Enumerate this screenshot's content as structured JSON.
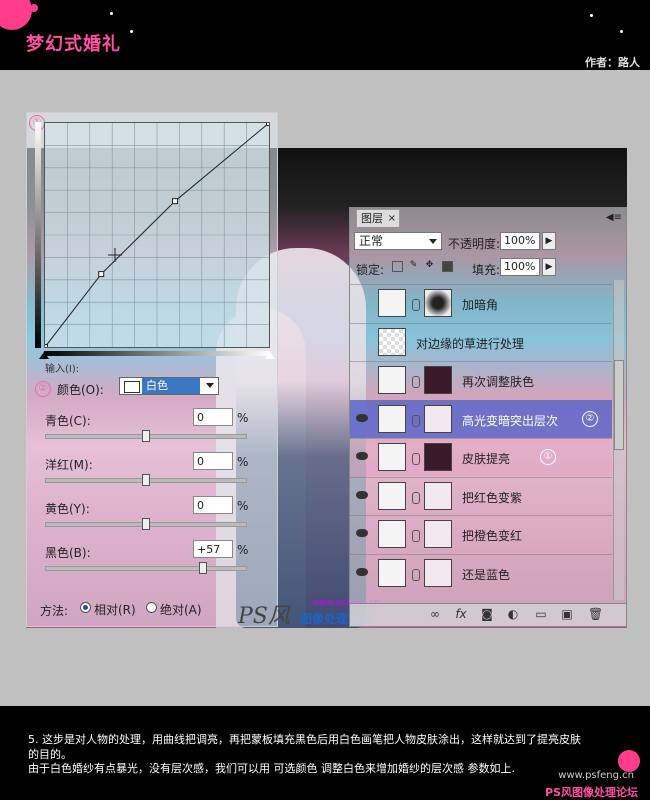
{
  "header": {
    "site_title": "梦幻式婚礼",
    "author": "作者：路人"
  },
  "curves": {
    "marker": "①",
    "input_label": "输入(I):",
    "points": [
      [
        0,
        0
      ],
      [
        64,
        83
      ],
      [
        148,
        166
      ],
      [
        255,
        255
      ]
    ],
    "grid_divisions": 10
  },
  "selective_color": {
    "marker": "②",
    "color_label": "颜色(O):",
    "color_value": "白色",
    "adjustments": [
      {
        "label": "青色(C):",
        "value": "0",
        "unit": "%",
        "level": 0
      },
      {
        "label": "洋红(M):",
        "value": "0",
        "unit": "%",
        "level": 0
      },
      {
        "label": "黄色(Y):",
        "value": "0",
        "unit": "%",
        "level": 0
      },
      {
        "label": "黑色(B):",
        "value": "+57",
        "unit": "%",
        "level": 57
      }
    ],
    "method_label": "方法:",
    "method_relative": "相对(R)",
    "method_absolute": "绝对(A)",
    "method_selected": "relative"
  },
  "layers": {
    "tab_label": "图层",
    "tab_close": "×",
    "blend_mode": "正常",
    "opacity_label": "不透明度:",
    "opacity_value": "100%",
    "lock_label": "锁定:",
    "fill_label": "填充:",
    "fill_value": "100%",
    "items": [
      {
        "name": "加暗角",
        "visible": false,
        "type": "curves",
        "mask": "vignette",
        "state": "normal"
      },
      {
        "name": "对边缘的草进行处理",
        "visible": false,
        "type": "pixel",
        "mask": "none",
        "state": "normal"
      },
      {
        "name": "再次调整肤色",
        "visible": false,
        "type": "selective",
        "mask": "dark",
        "state": "normal"
      },
      {
        "name": "高光变暗突出层次",
        "visible": true,
        "type": "selective",
        "mask": "light",
        "state": "selected",
        "marker": "②"
      },
      {
        "name": "皮肤提亮",
        "visible": true,
        "type": "curves",
        "mask": "dark",
        "state": "highlight",
        "marker": "①"
      },
      {
        "name": "把红色变紫",
        "visible": true,
        "type": "selective",
        "mask": "light",
        "state": "normal"
      },
      {
        "name": "把橙色变红",
        "visible": true,
        "type": "selective",
        "mask": "light",
        "state": "normal"
      },
      {
        "name": "还是蓝色",
        "visible": true,
        "type": "selective",
        "mask": "light",
        "state": "normal"
      }
    ]
  },
  "watermark": {
    "logo": "PS风",
    "url": "www.psfeng.cn",
    "name": "图像处理论坛"
  },
  "footer": {
    "caption_line1": "5. 这步是对人物的处理，用曲线把调亮，再把蒙板填充黑色后用白色画笔把人物皮肤涂出，这样就达到了提亮皮肤的目的。",
    "caption_line2": "由于白色婚纱有点暴光，没有层次感，我们可以用  可选颜色  调整白色来增加婚纱的层次感 参数如上.",
    "url": "www.psfeng.cn",
    "brand": "PS风图像处理论坛"
  },
  "colors": {
    "accent_pink": "#ff4fa0",
    "selection_blue": "#5c66c8"
  }
}
